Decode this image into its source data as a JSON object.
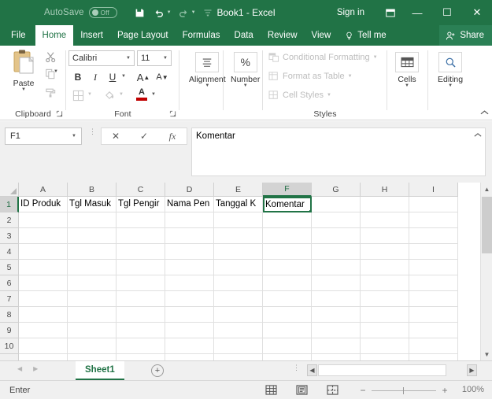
{
  "titlebar": {
    "autosave_label": "AutoSave",
    "autosave_state": "Off",
    "save_icon": "save-icon",
    "undo_icon": "undo-icon",
    "redo_icon": "redo-icon",
    "customize_icon": "customize-quick-access-icon",
    "title": "Book1  -  Excel",
    "signin": "Sign in",
    "ribbon_display_icon": "ribbon-display-options-icon",
    "minimize": "—",
    "restore": "☐",
    "close": "✕"
  },
  "tabs": [
    {
      "label": "File",
      "active": false
    },
    {
      "label": "Home",
      "active": true
    },
    {
      "label": "Insert",
      "active": false
    },
    {
      "label": "Page Layout",
      "active": false
    },
    {
      "label": "Formulas",
      "active": false
    },
    {
      "label": "Data",
      "active": false
    },
    {
      "label": "Review",
      "active": false
    },
    {
      "label": "View",
      "active": false
    }
  ],
  "tellme": {
    "label": "Tell me",
    "icon": "lightbulb-icon"
  },
  "share": {
    "label": "Share",
    "icon": "share-person-icon"
  },
  "ribbon": {
    "clipboard": {
      "label": "Clipboard",
      "paste_label": "Paste",
      "paste_icon": "paste-icon",
      "cut_icon": "cut-scissors-icon",
      "copy_icon": "copy-icon",
      "format_painter_icon": "format-painter-icon",
      "launcher_icon": "dialog-launcher-icon"
    },
    "font": {
      "label": "Font",
      "font_name": "Calibri",
      "font_size": "11",
      "bold": "B",
      "italic": "I",
      "underline": "U",
      "grow_font": "A",
      "shrink_font": "A",
      "borders_icon": "borders-icon",
      "fill_color_icon": "fill-color-icon",
      "font_color_icon": "font-color-icon",
      "font_color": "#c00000",
      "launcher_icon": "dialog-launcher-icon"
    },
    "alignment": {
      "label": "Alignment",
      "icon": "alignment-icon"
    },
    "number": {
      "label": "Number",
      "icon": "percent-icon"
    },
    "styles": {
      "label": "Styles",
      "items": [
        {
          "label": "Conditional Formatting",
          "icon": "conditional-formatting-icon"
        },
        {
          "label": "Format as Table",
          "icon": "format-as-table-icon"
        },
        {
          "label": "Cell Styles",
          "icon": "cell-styles-icon"
        }
      ]
    },
    "cells": {
      "label": "Cells",
      "icon": "cells-icon"
    },
    "editing": {
      "label": "Editing",
      "icon": "editing-magnifier-icon"
    },
    "collapse_icon": "collapse-ribbon-icon"
  },
  "formula_bar": {
    "name_box_value": "F1",
    "name_box_caret": "chevron-down-icon",
    "cancel_icon": "✕",
    "enter_icon": "✓",
    "function_icon": "fx",
    "content": "Komentar",
    "expand_icon": "collapse-formula-bar-icon"
  },
  "grid": {
    "columns": [
      "A",
      "B",
      "C",
      "D",
      "E",
      "F",
      "G",
      "H",
      "I"
    ],
    "selected_column": "F",
    "rows": [
      "1",
      "2",
      "3",
      "4",
      "5",
      "6",
      "7",
      "8",
      "9",
      "10"
    ],
    "selected_row": "1",
    "row1_values": [
      "ID Produk",
      "Tgl Masuk",
      "Tgl Pengir",
      "Nama Pen",
      "Tanggal K",
      "Komentar",
      "",
      "",
      ""
    ],
    "active_cell": "F1",
    "active_cell_value": "Komentar",
    "scroll_up_icon": "▲",
    "scroll_down_icon": "▼"
  },
  "sheetbar": {
    "prev_icon": "◀",
    "next_icon": "▶",
    "sheets": [
      {
        "label": "Sheet1",
        "active": true
      }
    ],
    "add_sheet_icon": "+",
    "hscroll_left_icon": "◀",
    "hscroll_right_icon": "▶"
  },
  "statusbar": {
    "mode": "Enter",
    "views": [
      {
        "name": "normal-view-icon"
      },
      {
        "name": "page-layout-view-icon"
      },
      {
        "name": "page-break-preview-icon"
      }
    ],
    "zoom_out": "−",
    "zoom_in": "+",
    "zoom_level": "100%"
  }
}
